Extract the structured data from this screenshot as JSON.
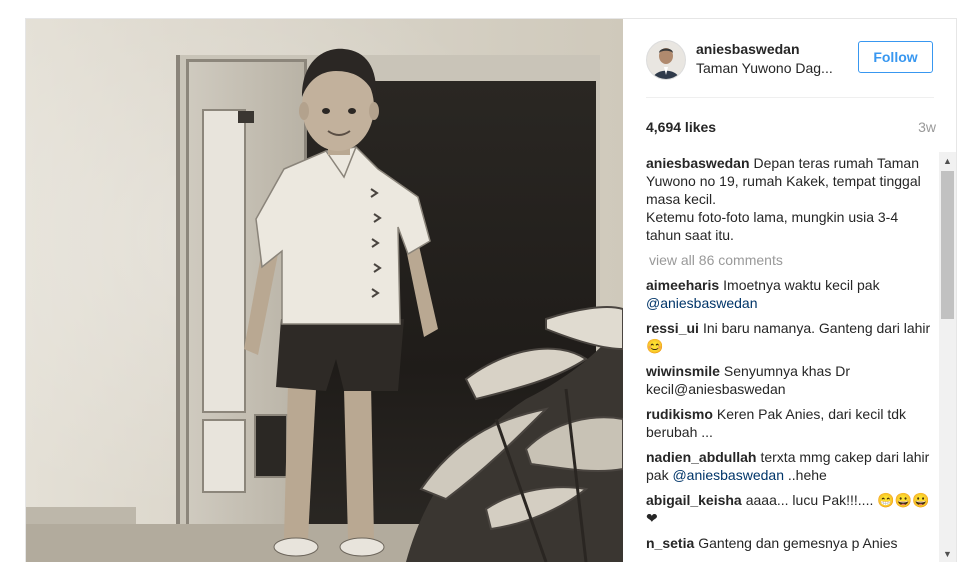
{
  "post": {
    "username": "aniesbaswedan",
    "location": "Taman Yuwono Dag...",
    "follow_label": "Follow",
    "likes": "4,694 likes",
    "age": "3w",
    "caption": {
      "user": "aniesbaswedan",
      "text": "Depan teras rumah Taman Yuwono no 19, rumah Kakek, tempat tinggal masa kecil.\nKetemu foto-foto lama, mungkin usia 3-4 tahun saat itu."
    },
    "view_all": "view all 86 comments",
    "comments": [
      {
        "user": "aimeeharis",
        "text": "Imoetnya waktu kecil pak ",
        "mention": "@aniesbaswedan",
        "after": ""
      },
      {
        "user": "ressi_ui",
        "text": "Ini baru namanya. Ganteng dari lahir 😊",
        "mention": "",
        "after": ""
      },
      {
        "user": "wiwinsmile",
        "text": "Senyumnya khas Dr kecil@aniesbaswedan",
        "mention": "",
        "after": ""
      },
      {
        "user": "rudikismo",
        "text": "Keren Pak Anies, dari kecil tdk berubah ...",
        "mention": "",
        "after": ""
      },
      {
        "user": "nadien_abdullah",
        "text": "terxta mmg cakep dari lahir pak ",
        "mention": "@aniesbaswedan",
        "after": " ..hehe"
      },
      {
        "user": "abigail_keisha",
        "text": "aaaa... lucu Pak!!!.... 😁😀😀❤",
        "mention": "",
        "after": ""
      },
      {
        "user": "n_setia",
        "text": "Ganteng dan gemesnya p Anies",
        "mention": "",
        "after": ""
      }
    ]
  },
  "icons": {
    "scroll_up": "scroll-up-arrow",
    "scroll_down": "scroll-down-arrow"
  },
  "colors": {
    "accent": "#3897f0",
    "mention": "#003569",
    "muted": "#999999"
  }
}
